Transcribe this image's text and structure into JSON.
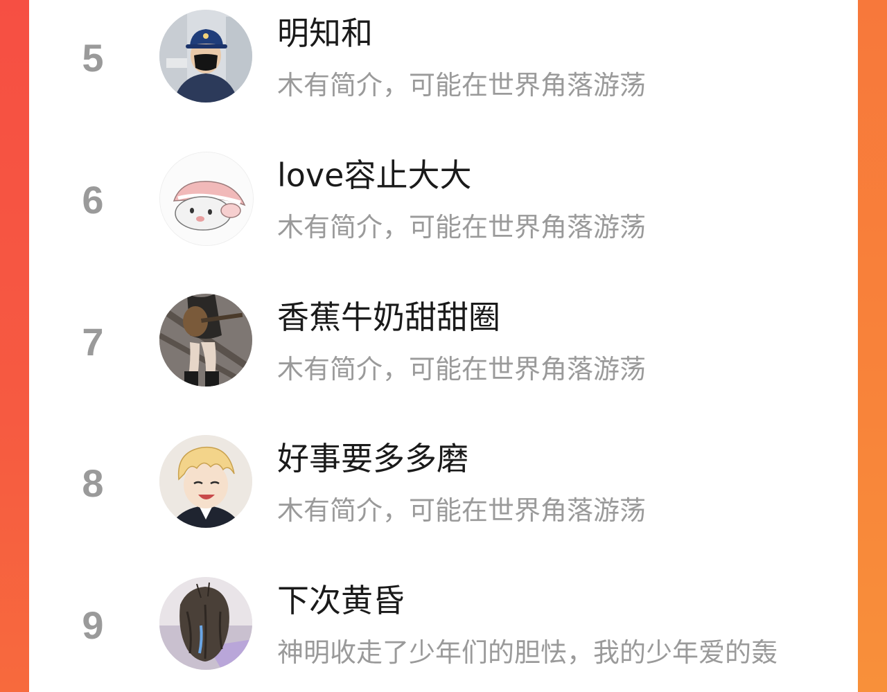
{
  "users": [
    {
      "rank": "5",
      "name": "明知和",
      "bio": "木有简介，可能在世界角落游荡",
      "avatar_icon": "person-in-cap-mask-avatar"
    },
    {
      "rank": "6",
      "name": "love容止大大",
      "bio": "木有简介，可能在世界角落游荡",
      "avatar_icon": "hamster-cartoon-avatar"
    },
    {
      "rank": "7",
      "name": "香蕉牛奶甜甜圈",
      "bio": "木有简介，可能在世界角落游荡",
      "avatar_icon": "girl-with-guitar-avatar"
    },
    {
      "rank": "8",
      "name": "好事要多多磨",
      "bio": "木有简介，可能在世界角落游荡",
      "avatar_icon": "anime-boy-avatar"
    },
    {
      "rank": "9",
      "name": "下次黄昏",
      "bio": "神明收走了少年们的胆怯，我的少年爱的轰",
      "avatar_icon": "girl-back-of-head-avatar"
    }
  ],
  "colors": {
    "accent_left": "#f64f43",
    "accent_right": "#f8843a",
    "rank_text": "#9a9a9a",
    "name_text": "#1a1a1a",
    "bio_text": "#9a9a9a"
  }
}
